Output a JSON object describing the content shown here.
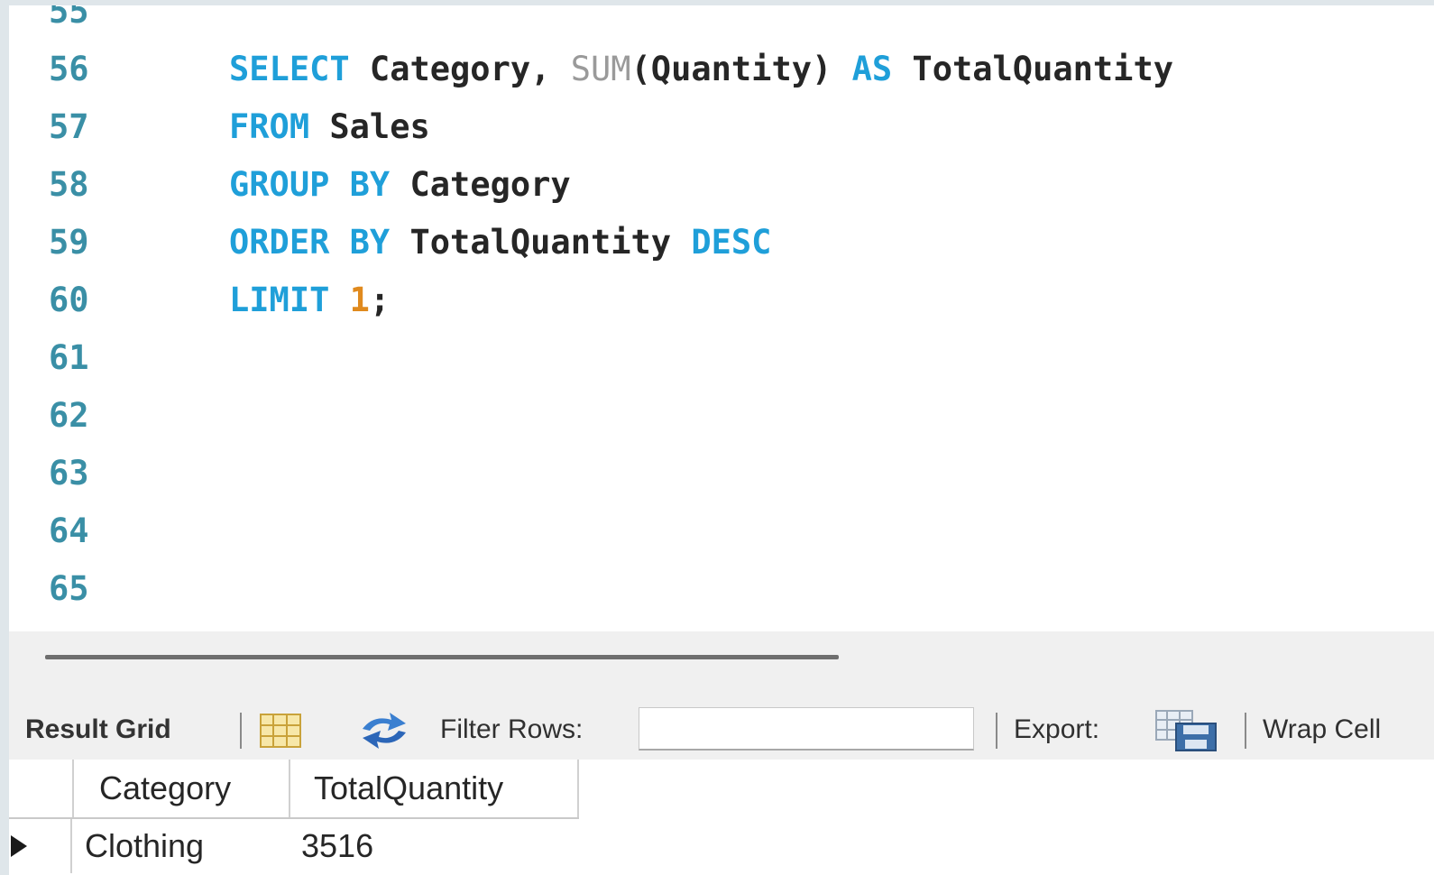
{
  "editor": {
    "lines": [
      {
        "number": "55",
        "tokens": []
      },
      {
        "number": "56",
        "tokens": [
          {
            "text": "SELECT",
            "type": "keyword"
          },
          {
            "text": " Category, ",
            "type": "ident"
          },
          {
            "text": "SUM",
            "type": "func"
          },
          {
            "text": "(Quantity) ",
            "type": "ident"
          },
          {
            "text": "AS",
            "type": "keyword"
          },
          {
            "text": " TotalQuantity",
            "type": "ident"
          }
        ]
      },
      {
        "number": "57",
        "tokens": [
          {
            "text": "FROM",
            "type": "keyword"
          },
          {
            "text": " Sales",
            "type": "ident"
          }
        ]
      },
      {
        "number": "58",
        "tokens": [
          {
            "text": "GROUP BY",
            "type": "keyword"
          },
          {
            "text": " Category",
            "type": "ident"
          }
        ]
      },
      {
        "number": "59",
        "tokens": [
          {
            "text": "ORDER BY",
            "type": "keyword"
          },
          {
            "text": " TotalQuantity ",
            "type": "ident"
          },
          {
            "text": "DESC",
            "type": "keyword"
          }
        ]
      },
      {
        "number": "60",
        "tokens": [
          {
            "text": "LIMIT",
            "type": "keyword"
          },
          {
            "text": " ",
            "type": "ident"
          },
          {
            "text": "1",
            "type": "number"
          },
          {
            "text": ";",
            "type": "punct"
          }
        ]
      },
      {
        "number": "61",
        "tokens": []
      },
      {
        "number": "62",
        "tokens": []
      },
      {
        "number": "63",
        "tokens": []
      },
      {
        "number": "64",
        "tokens": []
      },
      {
        "number": "65",
        "tokens": []
      }
    ]
  },
  "toolbar": {
    "result_grid_label": "Result Grid",
    "grid_icon": "grid-layout-icon",
    "refresh_icon": "refresh-icon",
    "filter_label": "Filter Rows:",
    "filter_value": "",
    "export_label": "Export:",
    "export_icon": "export-save-icon",
    "wrap_label": "Wrap Cell"
  },
  "result_grid": {
    "columns": [
      "Category",
      "TotalQuantity"
    ],
    "rows": [
      [
        "Clothing",
        "3516"
      ]
    ]
  },
  "colors": {
    "keyword": "#1f9fd9",
    "line_number": "#3a8fa6",
    "number_literal": "#e08a1e",
    "function": "#9a9a9a"
  }
}
